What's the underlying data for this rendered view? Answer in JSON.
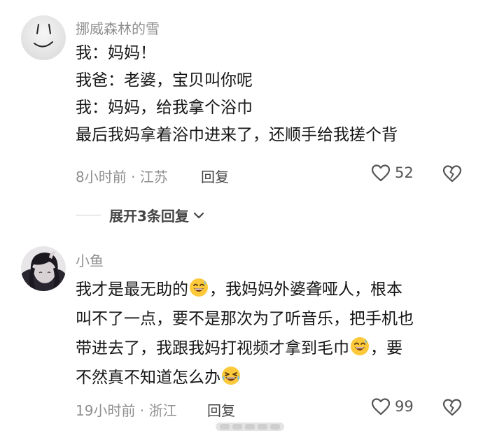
{
  "comments": [
    {
      "username": "挪威森林的雪",
      "lines": [
        "我：妈妈！",
        "我爸：老婆，宝贝叫你呢",
        "我：妈妈，给我拿个浴巾",
        "最后我妈拿着浴巾进来了，还顺手给我搓个背"
      ],
      "meta": "8小时前 · 江苏",
      "reply_label": "回复",
      "likes": "52"
    },
    {
      "username": "小鱼",
      "line1_a": "我才是最无助的",
      "line1_b": "，我妈妈外婆聋哑人，根本",
      "line2": "叫不了一点，要不是那次为了听音乐，把手机也",
      "line3_a": "带进去了，我跟我妈打视频才拿到毛巾",
      "line3_b": "，要",
      "line4": "不然真不知道怎么办",
      "meta": "19小时前 · 浙江",
      "reply_label": "回复",
      "likes": "99"
    }
  ],
  "expand_replies_label": "展开3条回复",
  "icons": {
    "like": "heart-outline-icon",
    "dislike": "broken-heart-icon",
    "expand": "chevron-down-icon",
    "emoji_smile": "grinning-sweat-emoji",
    "emoji_laugh": "laughing-tears-emoji"
  }
}
